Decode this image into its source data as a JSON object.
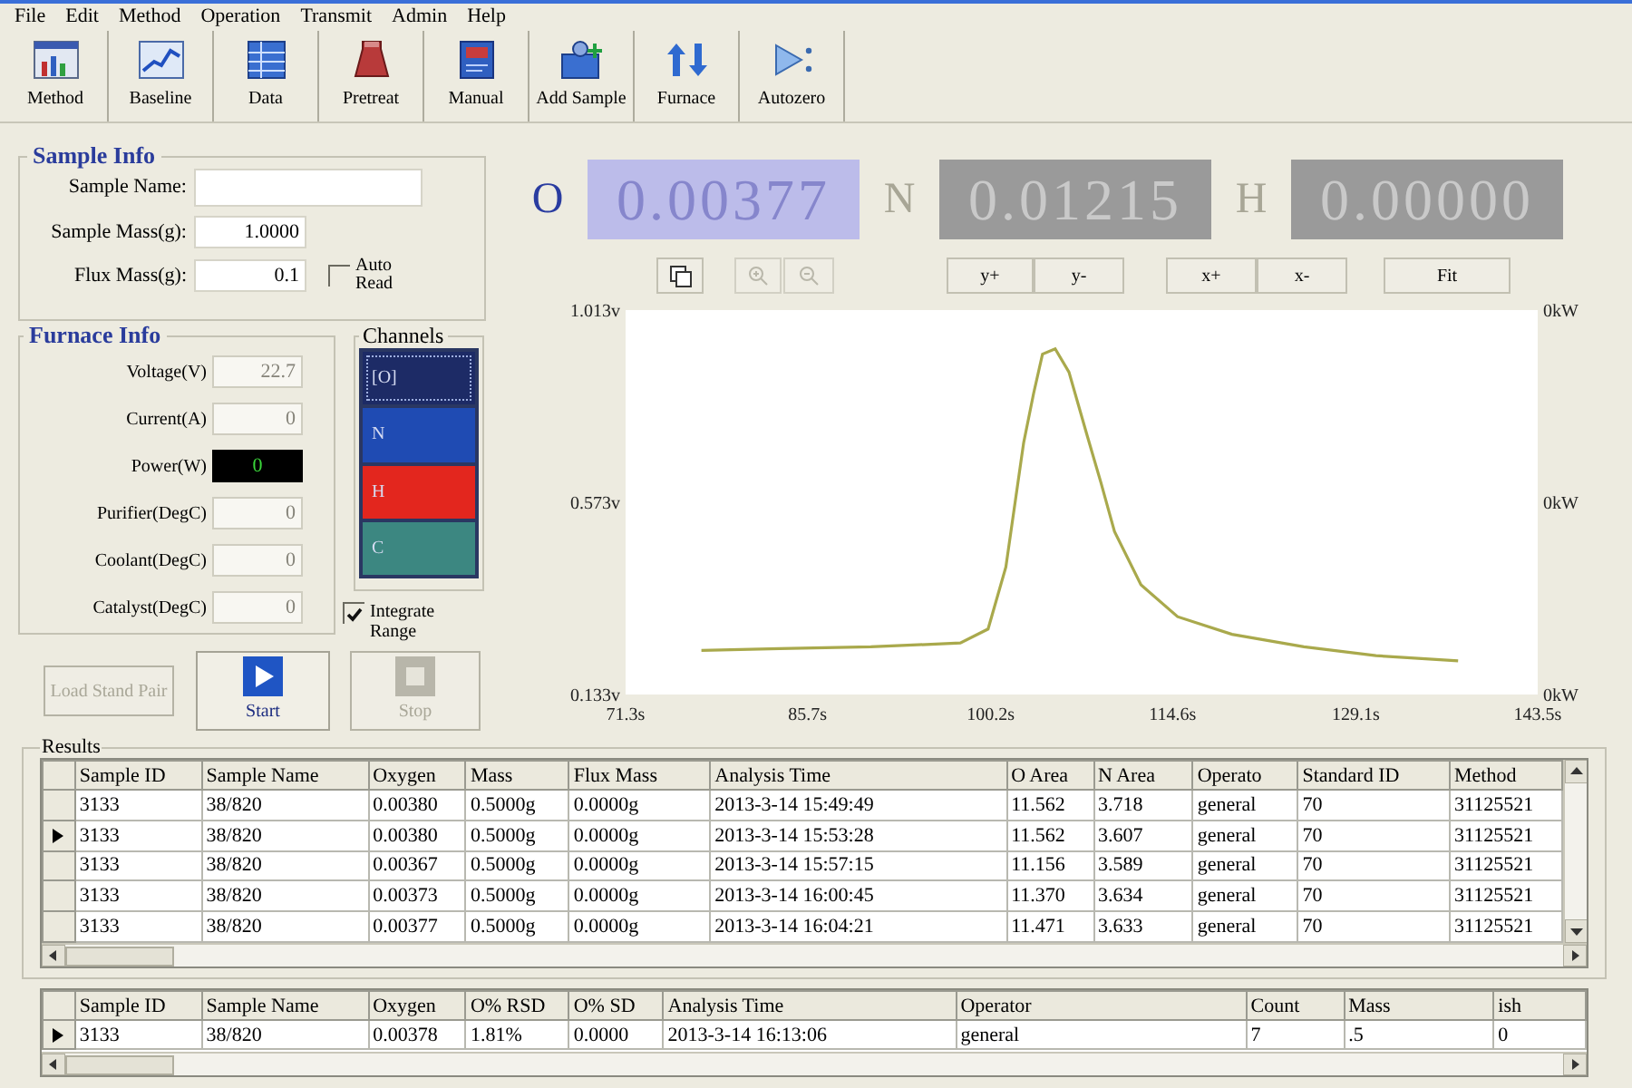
{
  "menu": [
    "File",
    "Edit",
    "Method",
    "Operation",
    "Transmit",
    "Admin",
    "Help"
  ],
  "toolbar": [
    {
      "label": "Method",
      "kind": "method"
    },
    {
      "label": "Baseline",
      "kind": "baseline"
    },
    {
      "label": "Data",
      "kind": "data"
    },
    {
      "label": "Pretreat",
      "kind": "pretreat"
    },
    {
      "label": "Manual",
      "kind": "manual"
    },
    {
      "label": "Add Sample",
      "kind": "add"
    },
    {
      "label": "Furnace",
      "kind": "furnace"
    },
    {
      "label": "Autozero",
      "kind": "autozero"
    }
  ],
  "sample_info": {
    "title": "Sample Info",
    "fields": [
      {
        "label": "Sample Name:",
        "kind": "wide"
      },
      {
        "label": "Sample Mass(g):",
        "value": "1.0000",
        "kind": "narrow"
      },
      {
        "label": "Flux Mass(g):",
        "value": "0.1",
        "kind": "narrow"
      }
    ],
    "auto_read": {
      "label": "Auto Read",
      "checked": false
    }
  },
  "furnace_info": {
    "title": "Furnace Info",
    "fields": [
      {
        "label": "Voltage(V)",
        "value": "22.7",
        "kind": "field"
      },
      {
        "label": "Current(A)",
        "value": "0",
        "kind": "field"
      },
      {
        "label": "Power(W)",
        "value": "0",
        "kind": "meter"
      },
      {
        "label": "Purifier(DegC)",
        "value": "0",
        "kind": "field"
      },
      {
        "label": "Coolant(DegC)",
        "value": "0",
        "kind": "field"
      },
      {
        "label": "Catalyst(DegC)",
        "value": "0",
        "kind": "field"
      }
    ]
  },
  "channels": {
    "title": "Channels",
    "items": [
      {
        "label": "[O]",
        "color": "#1d2b66",
        "selected": true
      },
      {
        "label": "N",
        "color": "#1f4bb3",
        "selected": false
      },
      {
        "label": "H",
        "color": "#e3261e",
        "selected": false
      },
      {
        "label": "C",
        "color": "#3c8781",
        "selected": false
      }
    ]
  },
  "integrate_range": {
    "label": "Integrate Range",
    "checked": true
  },
  "buttons": [
    {
      "label": "Load Stand Pair",
      "kind": "text",
      "disabled": true
    },
    {
      "label": "Start",
      "kind": "start",
      "disabled": false
    },
    {
      "label": "Stop",
      "kind": "stop",
      "disabled": true
    }
  ],
  "readouts": [
    {
      "label": "O",
      "value": "0.00377",
      "active": true
    },
    {
      "label": "N",
      "value": "0.01215",
      "active": false
    },
    {
      "label": "H",
      "value": "0.00000",
      "active": false
    }
  ],
  "chart": {
    "buttons": [
      "y+",
      "y-",
      "x+",
      "x-",
      "Fit"
    ],
    "right_labels": [
      "0kW",
      "0kW",
      "0kW"
    ],
    "chart_data": {
      "type": "line",
      "x": [
        77.3,
        83.5,
        90.7,
        97.8,
        100.0,
        101.4,
        102.8,
        103.6,
        104.3,
        105.3,
        106.4,
        107.8,
        108.9,
        110.0,
        112.1,
        115.0,
        119.3,
        125.0,
        130.7,
        137.2
      ],
      "values": [
        0.234,
        0.238,
        0.242,
        0.251,
        0.283,
        0.425,
        0.709,
        0.822,
        0.912,
        0.924,
        0.871,
        0.729,
        0.62,
        0.506,
        0.384,
        0.311,
        0.271,
        0.242,
        0.222,
        0.21
      ],
      "xlim": [
        71.3,
        143.5
      ],
      "ylim": [
        0.133,
        1.013
      ],
      "xticks": [
        {
          "value": 71.3,
          "label": "71.3s"
        },
        {
          "value": 85.7,
          "label": "85.7s"
        },
        {
          "value": 100.2,
          "label": "100.2s"
        },
        {
          "value": 114.6,
          "label": "114.6s"
        },
        {
          "value": 129.1,
          "label": "129.1s"
        },
        {
          "value": 143.5,
          "label": "143.5s"
        }
      ],
      "yticks": [
        {
          "value": 1.013,
          "label": "1.013v"
        },
        {
          "value": 0.573,
          "label": "0.573v"
        },
        {
          "value": 0.133,
          "label": "0.133v"
        }
      ]
    }
  },
  "results": {
    "title": "Results",
    "columns": [
      "Sample ID",
      "Sample Name",
      "Oxygen",
      "Mass",
      "Flux Mass",
      "Analysis Time",
      "O Area",
      "N Area",
      "Operato",
      "Standard ID",
      "Method"
    ],
    "rows": [
      {
        "selected": false,
        "cells": [
          "3133",
          "38/820",
          "0.00380",
          "0.5000g",
          "0.0000g",
          "2013-3-14 15:49:49",
          "11.562",
          "3.718",
          "general",
          "70",
          "31125521"
        ]
      },
      {
        "selected": true,
        "cells": [
          "3133",
          "38/820",
          "0.00380",
          "0.5000g",
          "0.0000g",
          "2013-3-14 15:53:28",
          "11.562",
          "3.607",
          "general",
          "70",
          "31125521"
        ]
      },
      {
        "selected": false,
        "cells": [
          "3133",
          "38/820",
          "0.00367",
          "0.5000g",
          "0.0000g",
          "2013-3-14 15:57:15",
          "11.156",
          "3.589",
          "general",
          "70",
          "31125521"
        ]
      },
      {
        "selected": false,
        "cells": [
          "3133",
          "38/820",
          "0.00373",
          "0.5000g",
          "0.0000g",
          "2013-3-14 16:00:45",
          "11.370",
          "3.634",
          "general",
          "70",
          "31125521"
        ]
      },
      {
        "selected": false,
        "cells": [
          "3133",
          "38/820",
          "0.00377",
          "0.5000g",
          "0.0000g",
          "2013-3-14 16:04:21",
          "11.471",
          "3.633",
          "general",
          "70",
          "31125521"
        ]
      }
    ]
  },
  "summary": {
    "columns": [
      "Sample ID",
      "Sample Name",
      "Oxygen",
      "O% RSD",
      "O% SD",
      "Analysis Time",
      "Operator",
      "Count",
      "Mass",
      "ish"
    ],
    "rows": [
      {
        "selected": true,
        "cells": [
          "3133",
          "38/820",
          "0.00378",
          "1.81%",
          "0.0000",
          "2013-3-14 16:13:06",
          "general",
          "7",
          ".5",
          "0"
        ]
      }
    ]
  }
}
